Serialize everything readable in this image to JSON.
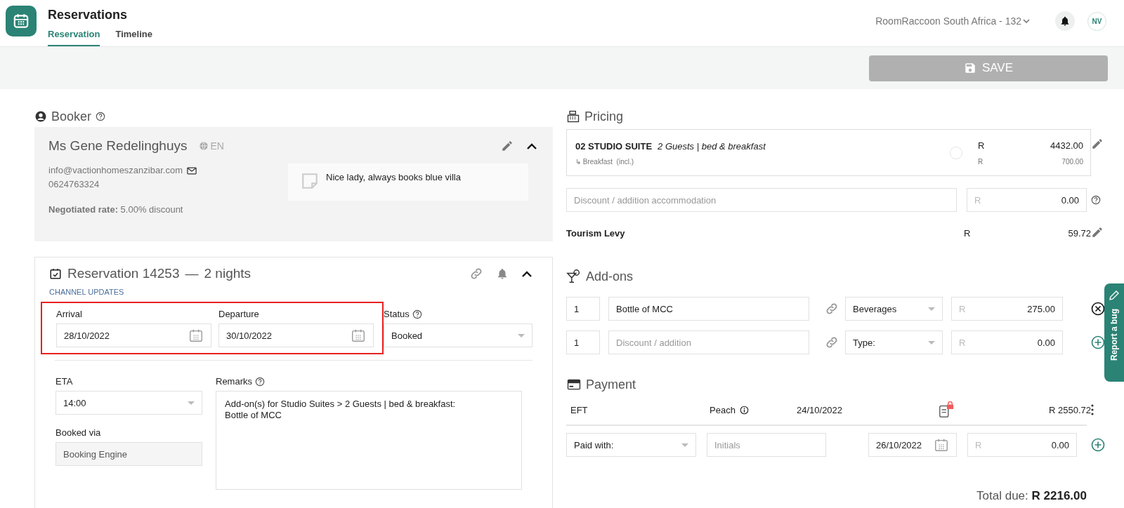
{
  "app": {
    "title": "Reservations",
    "tabs": [
      {
        "label": "Reservation",
        "selected": true
      },
      {
        "label": "Timeline",
        "selected": false
      }
    ],
    "property": "RoomRaccoon South Africa - 132",
    "avatar": "NV"
  },
  "toolbar": {
    "save": {
      "label": "SAVE",
      "disabled": true
    }
  },
  "booker": {
    "title": "Booker",
    "name": "Ms Gene Redelinghuys",
    "language": "EN",
    "email": "info@vactionhomeszanzibar.com",
    "phone": "0624763324",
    "rate_label": "Negotiated rate:",
    "rate_value": "5.00% discount",
    "note": "Nice lady, always books blue villa",
    "expanded": true
  },
  "reservation": {
    "title": "Reservation 14253",
    "separator": "—",
    "nights": "2 nights",
    "channel_updates": "CHANNEL UPDATES",
    "expanded": true,
    "highlighted": true,
    "arrival": {
      "label": "Arrival",
      "value": "28/10/2022"
    },
    "departure": {
      "label": "Departure",
      "value": "30/10/2022"
    },
    "status": {
      "label": "Status",
      "value": "Booked"
    },
    "eta": {
      "label": "ETA",
      "value": "14:00"
    },
    "booked_via": {
      "label": "Booked via",
      "value": "Booking Engine",
      "disabled": true
    },
    "remarks": {
      "label": "Remarks",
      "value": "Add-on(s) for Studio Suites > 2 Guests | bed & breakfast:\nBottle of MCC"
    }
  },
  "pricing": {
    "title": "Pricing",
    "room": {
      "name": "02 STUDIO SUITE",
      "details": "2 Guests | bed & breakfast",
      "currency": "R",
      "amount": "4432.00",
      "extra_marker": "↳",
      "extra": "Breakfast  (incl.)",
      "extra_currency": "R",
      "extra_amount": "700.00"
    },
    "discount": {
      "placeholder": "Discount / addition accommodation",
      "currency": "R",
      "amount": "0.00"
    },
    "levy": {
      "label": "Tourism Levy",
      "currency": "R",
      "amount": "59.72"
    }
  },
  "addons": {
    "title": "Add-ons",
    "rows": [
      {
        "qty": "1",
        "name": "Bottle of MCC",
        "type": "Beverages",
        "currency": "R",
        "amount": "275.00",
        "kind": "remove"
      },
      {
        "qty": "1",
        "name_placeholder": "Discount / addition",
        "type": "Type:",
        "currency": "R",
        "amount": "0.00",
        "kind": "add"
      }
    ]
  },
  "payment": {
    "title": "Payment",
    "entries": [
      {
        "method": "EFT",
        "provider": "Peach",
        "date": "24/10/2022",
        "locked": true,
        "amount": "R 2550.72"
      }
    ],
    "new": {
      "method": "Paid with:",
      "initials_placeholder": "Initials",
      "date": "26/10/2022",
      "currency": "R",
      "amount": "0.00"
    }
  },
  "total": {
    "label": "Total due:",
    "amount": "R 2216.00"
  },
  "report_bug": "Report a bug"
}
